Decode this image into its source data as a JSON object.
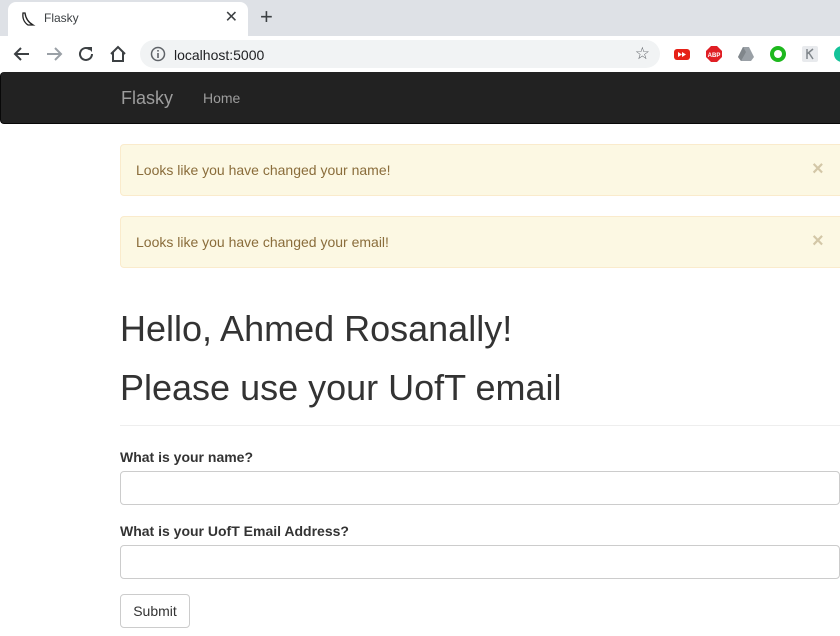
{
  "browser": {
    "tab_title": "Flasky",
    "close_glyph": "✕",
    "new_tab_glyph": "+",
    "url": "localhost:5000",
    "star_glyph": "☆",
    "extensions": [
      "youtube-icon",
      "adblock-plus-icon",
      "google-drive-icon",
      "grammar-extension-icon",
      "keep-icon",
      "grammarly-icon"
    ],
    "extension_colors": {
      "red": "#e62117",
      "abp": "#e01f25",
      "green": "#1eb81e",
      "teal": "#15c39a"
    }
  },
  "navbar": {
    "brand": "Flasky",
    "home": "Home"
  },
  "alerts": [
    {
      "text": "Looks like you have changed your name!",
      "close": "×"
    },
    {
      "text": "Looks like you have changed your email!",
      "close": "×"
    }
  ],
  "page": {
    "greeting": "Hello, Ahmed Rosanally!",
    "subheading": "Please use your UofT email"
  },
  "form": {
    "name_label": "What is your name?",
    "name_value": "",
    "email_label": "What is your UofT Email Address?",
    "email_value": "",
    "submit_label": "Submit"
  }
}
